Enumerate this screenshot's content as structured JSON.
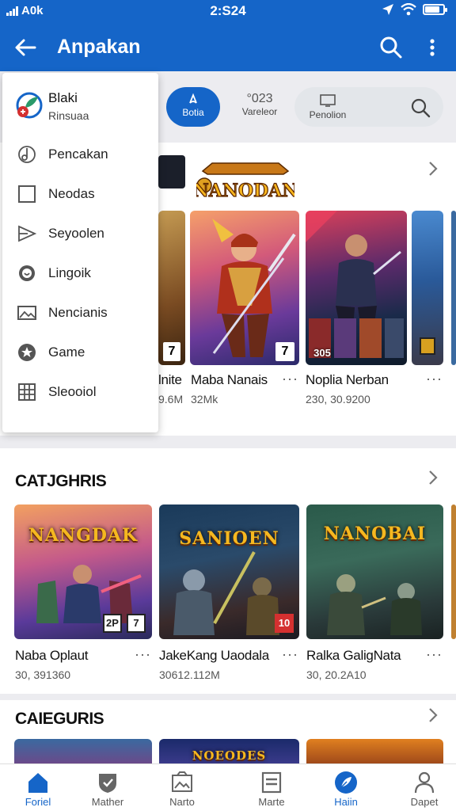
{
  "status_bar": {
    "carrier": "A0k",
    "time": "2:S24",
    "battery_level": 0.8
  },
  "app_bar": {
    "title": "Anpakan"
  },
  "chips": [
    {
      "label": "Botia"
    },
    {
      "number": "°023",
      "label": "Vareleor"
    },
    {
      "label": "Penolion"
    }
  ],
  "drawer": {
    "header": {
      "title": "Blaki",
      "subtitle": "Rinsuaa"
    },
    "items": [
      {
        "label": "Pencakan",
        "icon": "music-note-icon"
      },
      {
        "label": "Neodas",
        "icon": "square-outline-icon"
      },
      {
        "label": "Seyoolen",
        "icon": "send-icon"
      },
      {
        "label": "Lingoik",
        "icon": "face-circle-icon"
      },
      {
        "label": "Nencianis",
        "icon": "image-icon"
      },
      {
        "label": "Game",
        "icon": "star-badge-icon"
      },
      {
        "label": "Sleooiol",
        "icon": "grid-icon"
      }
    ]
  },
  "featured": {
    "logo_text": "NANODAN",
    "apps": [
      {
        "name": "lnite",
        "meta": "9.6M",
        "badge": "7"
      },
      {
        "name": "Maba Nanais",
        "meta": "32Mk",
        "badge": "7"
      },
      {
        "name": "Noplia Nerban",
        "meta": "230, 30.9200",
        "badge": "305"
      },
      {
        "name": "",
        "meta": ""
      }
    ]
  },
  "categories_1": {
    "title": "CATJGHRIS",
    "apps": [
      {
        "name": "Naba Oplaut",
        "meta": "30, 391360",
        "banner": "NANGDAK",
        "badge_a": "2P",
        "badge_b": "7"
      },
      {
        "name": "JakeKang Uaodala",
        "meta": "30612.112M",
        "banner": "SANIOEN",
        "badge_b": "10"
      },
      {
        "name": "Ralka GaligNata",
        "meta": "30, 20.2A10",
        "banner": "NANOBAI"
      }
    ]
  },
  "categories_2": {
    "title": "CAIEGURIS",
    "apps": [
      {
        "banner": ""
      },
      {
        "banner": "NOEODES"
      },
      {
        "banner": ""
      }
    ]
  },
  "bottom_nav": [
    {
      "label": "Foriel",
      "icon": "home-icon",
      "active": true
    },
    {
      "label": "Mather",
      "icon": "shield-check-icon",
      "active": false
    },
    {
      "label": "Narto",
      "icon": "photo-icon",
      "active": false
    },
    {
      "label": "Marte",
      "icon": "document-icon",
      "active": false
    },
    {
      "label": "Haiin",
      "icon": "leaf-circle-icon",
      "active": true
    },
    {
      "label": "Dapet",
      "icon": "person-icon",
      "active": false
    }
  ],
  "colors": {
    "primary": "#1565c8",
    "banner_gold": "#f5b820"
  }
}
